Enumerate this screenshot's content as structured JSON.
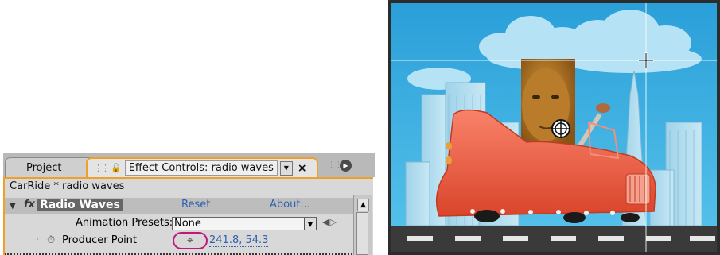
{
  "effect_controls": {
    "tabs": {
      "project": "Project",
      "effect_controls": "Effect Controls: radio waves",
      "close": "×"
    },
    "composition_label": "CarRide * radio waves",
    "effect": {
      "name": "Radio Waves",
      "fx_badge": "fx",
      "reset_label": "Reset",
      "about_label": "About..."
    },
    "animation_presets": {
      "label": "Animation Presets:",
      "value": "None"
    },
    "producer_point": {
      "label": "Producer Point",
      "value": "241.8, 54.3"
    }
  },
  "comp_viewer": {
    "producer_point_marker_icon": "crosshair-circle-icon",
    "guide_cross_icon": "plus-crosshair-icon"
  },
  "colors": {
    "panel_accent": "#f0a02a",
    "highlight_ring": "#c0187a",
    "link": "#3060b0",
    "sky": "#3fb0e0",
    "car": "#ee5a3c"
  }
}
